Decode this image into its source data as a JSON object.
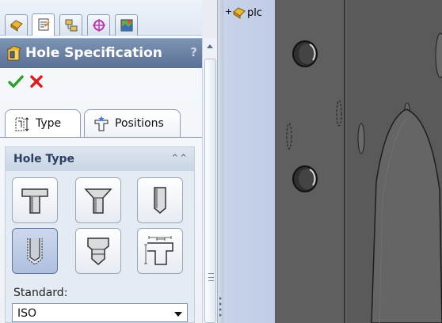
{
  "manager_tabs": [
    {
      "icon": "feature-manager-icon",
      "active": false
    },
    {
      "icon": "property-manager-icon",
      "active": true
    },
    {
      "icon": "configuration-manager-icon",
      "active": false
    },
    {
      "icon": "dimxpert-manager-icon",
      "active": false
    },
    {
      "icon": "display-manager-icon",
      "active": false
    }
  ],
  "property_manager": {
    "title": "Hole Specification",
    "help": "?",
    "ok_icon": "checkmark-icon",
    "cancel_icon": "x-icon"
  },
  "subtabs": [
    {
      "label": "Type",
      "icon": "type-icon",
      "active": true
    },
    {
      "label": "Positions",
      "icon": "positions-icon",
      "active": false
    }
  ],
  "hole_type": {
    "title": "Hole Type",
    "buttons": [
      {
        "name": "counterbore",
        "selected": false
      },
      {
        "name": "countersink",
        "selected": false
      },
      {
        "name": "hole",
        "selected": false
      },
      {
        "name": "straight-tap",
        "selected": true
      },
      {
        "name": "tapered-tap",
        "selected": false
      },
      {
        "name": "legacy-hole",
        "selected": false
      }
    ],
    "standard_label": "Standard:",
    "standard_value": "ISO"
  },
  "viewport": {
    "tree_node_label": "plc",
    "tree_expand": "+",
    "colors": {
      "background": "#b8c6e4",
      "part": "#585858",
      "part_face": "#626262"
    }
  }
}
